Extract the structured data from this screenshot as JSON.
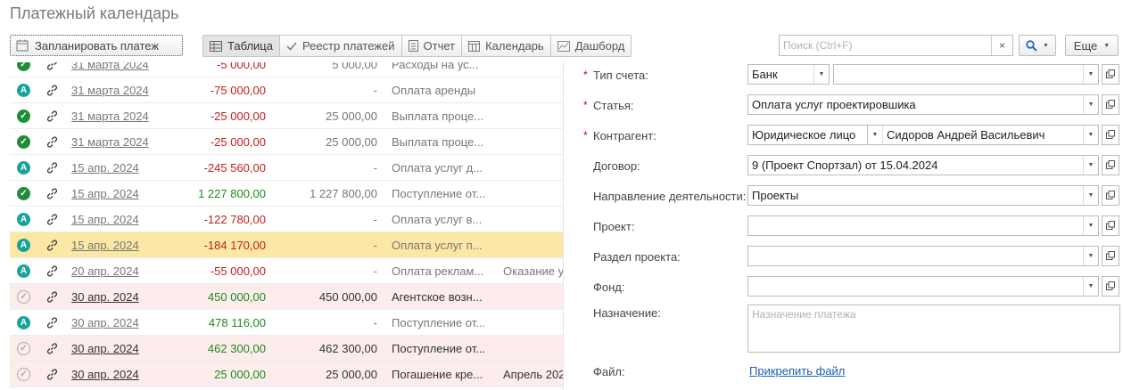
{
  "header": {
    "title": "Платежный календарь"
  },
  "toolbar": {
    "plan_label": "Запланировать платеж",
    "tabs": [
      {
        "label": "Таблица",
        "icon": "table-icon"
      },
      {
        "label": "Реестр платежей",
        "icon": "check-icon"
      },
      {
        "label": "Отчет",
        "icon": "report-icon"
      },
      {
        "label": "Календарь",
        "icon": "calendar-icon"
      },
      {
        "label": "Дашборд",
        "icon": "dashboard-icon"
      }
    ],
    "search_placeholder": "Поиск (Ctrl+F)",
    "clear_label": "×",
    "more_label": "Еще"
  },
  "colors": {
    "selected_row": "#fbe8a4",
    "plan_row": "#fdecec",
    "negative": "#c0201c",
    "positive": "#1d8b1d",
    "accent": "#1aa39a",
    "done": "#1f8e3a"
  },
  "rows": [
    {
      "status": "done",
      "date": "31 марта 2024",
      "amount": "-5 000,00",
      "paid": "5 000,00",
      "desc": "Расходы на ус...",
      "extra": "",
      "bg": "",
      "dark": false
    },
    {
      "status": "A",
      "date": "31 марта 2024",
      "amount": "-75 000,00",
      "paid": "-",
      "desc": "Оплата аренды",
      "extra": "",
      "bg": "",
      "dark": false
    },
    {
      "status": "done",
      "date": "31 марта 2024",
      "amount": "-25 000,00",
      "paid": "25 000,00",
      "desc": "Выплата проце...",
      "extra": "",
      "bg": "",
      "dark": false
    },
    {
      "status": "done",
      "date": "31 марта 2024",
      "amount": "-25 000,00",
      "paid": "25 000,00",
      "desc": "Выплата проце...",
      "extra": "",
      "bg": "",
      "dark": false
    },
    {
      "status": "A",
      "date": "15 апр. 2024",
      "amount": "-245 560,00",
      "paid": "-",
      "desc": "Оплата услуг д...",
      "extra": "",
      "bg": "",
      "dark": false
    },
    {
      "status": "done",
      "date": "15 апр. 2024",
      "amount": "1 227 800,00",
      "paid": "1 227 800,00",
      "desc": "Поступление от...",
      "extra": "",
      "bg": "",
      "dark": false
    },
    {
      "status": "A",
      "date": "15 апр. 2024",
      "amount": "-122 780,00",
      "paid": "-",
      "desc": "Оплата услуг в...",
      "extra": "",
      "bg": "",
      "dark": false
    },
    {
      "status": "A",
      "date": "15 апр. 2024",
      "amount": "-184 170,00",
      "paid": "-",
      "desc": "Оплата услуг п...",
      "extra": "",
      "bg": "sel",
      "dark": false
    },
    {
      "status": "A",
      "date": "20 апр. 2024",
      "amount": "-55 000,00",
      "paid": "-",
      "desc": "Оплата реклам...",
      "extra": "Оказание у",
      "bg": "",
      "dark": false
    },
    {
      "status": "plan",
      "date": "30 апр. 2024",
      "amount": "450 000,00",
      "paid": "450 000,00",
      "desc": "Агентское возн...",
      "extra": "",
      "bg": "pink",
      "dark": true
    },
    {
      "status": "A",
      "date": "30 апр. 2024",
      "amount": "478 116,00",
      "paid": "-",
      "desc": "Поступление от...",
      "extra": "",
      "bg": "",
      "dark": false
    },
    {
      "status": "plan",
      "date": "30 апр. 2024",
      "amount": "462 300,00",
      "paid": "462 300,00",
      "desc": "Поступление от...",
      "extra": "",
      "bg": "pink",
      "dark": true
    },
    {
      "status": "plan",
      "date": "30 апр. 2024",
      "amount": "25 000,00",
      "paid": "25 000,00",
      "desc": "Погашение кре...",
      "extra": "Апрель 202",
      "bg": "pink",
      "dark": true
    }
  ],
  "form": {
    "account_type_label": "Тип счета:",
    "account_type_value": "Банк",
    "account_value": "",
    "article_label": "Статья:",
    "article_value": "Оплата услуг проектировшика",
    "counterparty_label": "Контрагент:",
    "counterparty_type": "Юридическое лицо",
    "counterparty_value": "Сидоров Андрей Васильевич",
    "contract_label": "Договор:",
    "contract_value": "9 (Проект Спортзал) от 15.04.2024",
    "direction_label": "Направление деятельности:",
    "direction_value": "Проекты",
    "project_label": "Проект:",
    "project_value": "",
    "section_label": "Раздел проекта:",
    "section_value": "",
    "fund_label": "Фонд:",
    "fund_value": "",
    "purpose_label": "Назначение:",
    "purpose_placeholder": "Назначение платежа",
    "file_label": "Файл:",
    "attach_label": "Прикрепить файл",
    "required_mark": "*"
  }
}
